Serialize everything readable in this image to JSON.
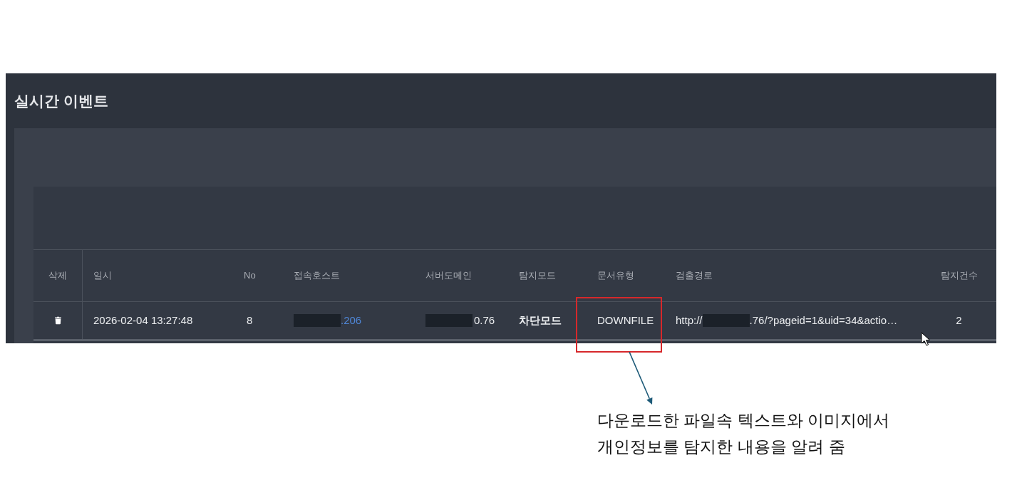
{
  "panel": {
    "title": "실시간 이벤트"
  },
  "table": {
    "columns": [
      "삭제",
      "일시",
      "No",
      "접속호스트",
      "서버도메인",
      "탐지모드",
      "문서유형",
      "검출경로",
      "탐지건수"
    ],
    "rows": [
      {
        "datetime": "2026-02-04 13:27:48",
        "no": "8",
        "host": {
          "redacted": true,
          "text": ".206"
        },
        "server_domain": {
          "redacted": true,
          "text": "0.76"
        },
        "detect_mode": "차단모드",
        "doc_type": "DOWNFILE",
        "highlighted": true,
        "path": {
          "prefix": "http://",
          "redacted": true,
          "text": ".76/?pageid=1&uid=34&actio…"
        },
        "count": "2"
      }
    ]
  },
  "annotation": {
    "lines": [
      "다운로드한 파일속 텍스트와 이미지에서",
      "개인정보를 탐지한 내용을 알려 줌"
    ]
  }
}
